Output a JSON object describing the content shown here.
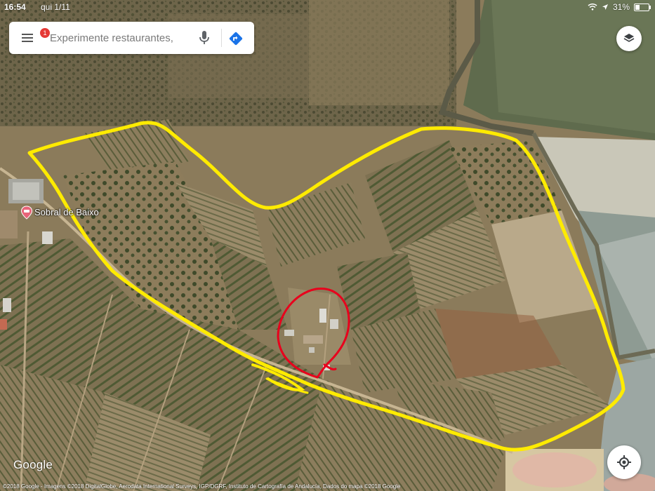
{
  "status_bar": {
    "time": "16:54",
    "date": "qui 1/11",
    "battery": "31%",
    "battery_level": 0.31
  },
  "search": {
    "placeholder": "Experimente restaurantes, c",
    "notification_count": "1"
  },
  "map": {
    "place_label": "Sobral de Baixo",
    "logo": "Google",
    "attribution": "©2018 Google - Imagens ©2018 DigitalGlobe, Aerodata International Surveys, IGP/DGRF, Instituto de Cartografía de Andalucía, Dados do mapa ©2018 Google"
  },
  "annotations": {
    "property_outline_color": "#ffeb00",
    "marker_circle_color": "#e8001c"
  },
  "icons": {
    "menu": "menu-icon",
    "mic": "mic-icon",
    "directions": "directions-icon",
    "layers": "layers-icon",
    "locate": "my-location-icon",
    "poi": "lodging-pin-icon"
  },
  "colors": {
    "directions_blue": "#1a73e8",
    "badge_red": "#e53935",
    "poi_pink": "#e86479"
  }
}
